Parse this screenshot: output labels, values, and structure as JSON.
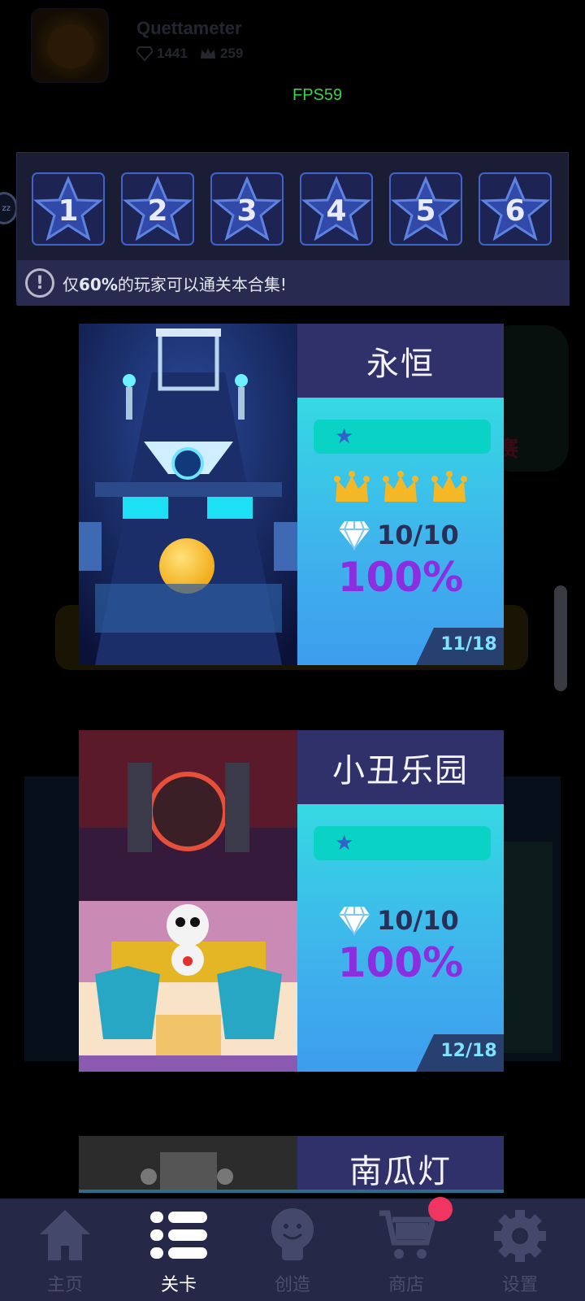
{
  "header": {
    "username": "Quettameter",
    "gems": "1441",
    "crowns": "259",
    "fps": "FPS59"
  },
  "star_levels": [
    "1",
    "2",
    "3",
    "4",
    "5",
    "6"
  ],
  "notice": {
    "text_prefix": "仅",
    "text_bold": "60%",
    "text_suffix": "的玩家可以通关本合集!"
  },
  "side_badge": "zz",
  "levels": [
    {
      "title": "永恒",
      "difficulty_stars": 1,
      "crowns": 3,
      "gems": "10/10",
      "percent": "100%",
      "index": "11/18"
    },
    {
      "title": "小丑乐园",
      "difficulty_stars": 1,
      "crowns": 0,
      "gems": "10/10",
      "percent": "100%",
      "index": "12/18"
    },
    {
      "title": "南瓜灯"
    }
  ],
  "nav": [
    {
      "label": "主页",
      "icon": "home-icon",
      "active": false
    },
    {
      "label": "关卡",
      "icon": "list-icon",
      "active": true
    },
    {
      "label": "创造",
      "icon": "lightbulb-icon",
      "active": false
    },
    {
      "label": "商店",
      "icon": "cart-icon",
      "active": false
    },
    {
      "label": "设置",
      "icon": "gear-icon",
      "active": false
    }
  ],
  "colors": {
    "accent_card": "#3fb4ec",
    "title_bar": "#30306a",
    "percent": "#8a2ee0",
    "crown": "#f4b826",
    "badge": "#f03660",
    "fps": "#3fcf4a"
  }
}
